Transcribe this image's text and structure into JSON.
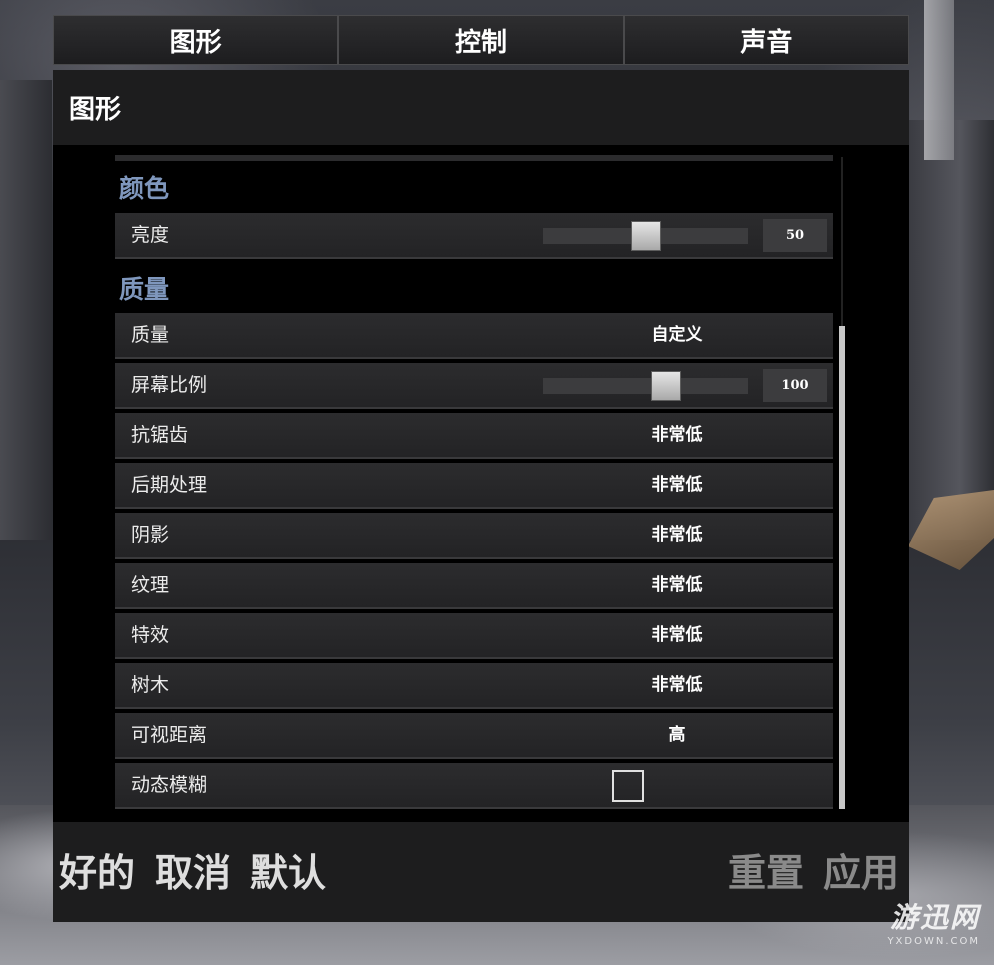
{
  "tabs": [
    {
      "label": "图形"
    },
    {
      "label": "控制"
    },
    {
      "label": "声音"
    }
  ],
  "header": {
    "title": "图形"
  },
  "sections": {
    "color": {
      "title": "颜色",
      "brightness": {
        "label": "亮度",
        "value": "50",
        "slider_fraction": 0.5
      }
    },
    "quality": {
      "title": "质量",
      "rows": [
        {
          "label": "质量",
          "value": "自定义"
        },
        {
          "label": "屏幕比例",
          "value": "100",
          "slider_fraction": 0.6
        },
        {
          "label": "抗锯齿",
          "value": "非常低"
        },
        {
          "label": "后期处理",
          "value": "非常低"
        },
        {
          "label": "阴影",
          "value": "非常低"
        },
        {
          "label": "纹理",
          "value": "非常低"
        },
        {
          "label": "特效",
          "value": "非常低"
        },
        {
          "label": "树木",
          "value": "非常低"
        },
        {
          "label": "可视距离",
          "value": "高"
        },
        {
          "label": "动态模糊",
          "checked": false
        }
      ]
    }
  },
  "footer": {
    "ok": "好的",
    "cancel": "取消",
    "default": "默认",
    "reset": "重置",
    "apply": "应用"
  },
  "watermark": {
    "main": "游迅网",
    "sub": "YXDOWN.COM"
  },
  "colors": {
    "section_title": "#7f97bd",
    "panel_bg": "#1d1d1e",
    "content_bg": "#000000"
  }
}
